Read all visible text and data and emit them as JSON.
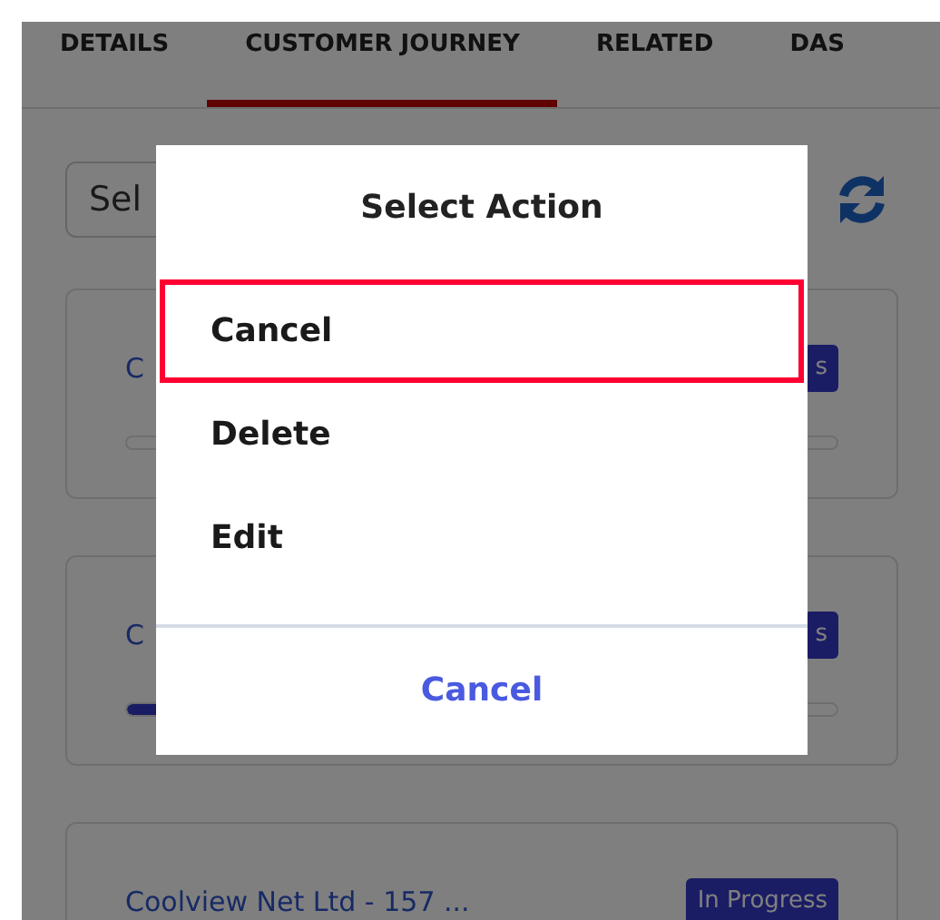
{
  "tabs": [
    {
      "label": "DETAILS",
      "selected": false
    },
    {
      "label": "CUSTOMER JOURNEY",
      "selected": true
    },
    {
      "label": "RELATED",
      "selected": false
    },
    {
      "label": "DAS",
      "selected": false
    }
  ],
  "filter": {
    "value": "Sel"
  },
  "cards": [
    {
      "title": "C",
      "status": "s",
      "level": 0
    },
    {
      "title": "C",
      "status": "s",
      "level": 0.1
    },
    {
      "title": "Coolview Net Ltd - 157 ...",
      "status": "In Progress"
    }
  ],
  "dialog": {
    "title": "Select Action",
    "actions": [
      {
        "label": "Cancel",
        "selected": true
      },
      {
        "label": "Delete",
        "selected": false
      },
      {
        "label": "Edit",
        "selected": false
      }
    ],
    "cancel": "Cancel"
  }
}
